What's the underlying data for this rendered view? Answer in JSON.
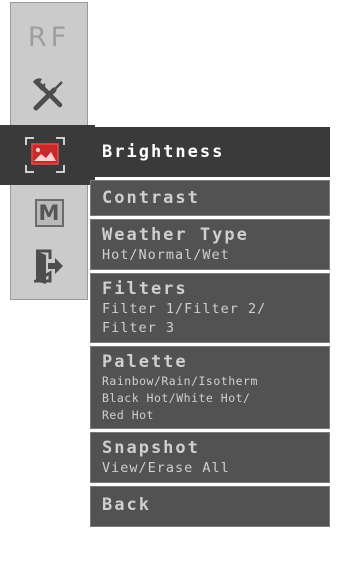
{
  "toolbar": {
    "rf_label": "RF",
    "mode_label": "M",
    "icons": [
      "rf-icon",
      "tools-icon",
      "image-icon",
      "mode-icon",
      "exit-icon"
    ],
    "active_color": "#d93030"
  },
  "menu": {
    "items": [
      {
        "title": "Brightness",
        "lines": []
      },
      {
        "title": "Contrast",
        "lines": []
      },
      {
        "title": "Weather Type",
        "lines": [
          "Hot/Normal/Wet"
        ]
      },
      {
        "title": "Filters",
        "lines": [
          "Filter 1/Filter 2/",
          "Filter 3"
        ]
      },
      {
        "title": "Palette",
        "lines": [
          "Rainbow/Rain/Isotherm",
          "Black Hot/White Hot/",
          "Red Hot"
        ]
      },
      {
        "title": "Snapshot",
        "lines": [
          "View/Erase All"
        ]
      },
      {
        "title": "Back",
        "lines": []
      }
    ],
    "selected_index": 0
  }
}
